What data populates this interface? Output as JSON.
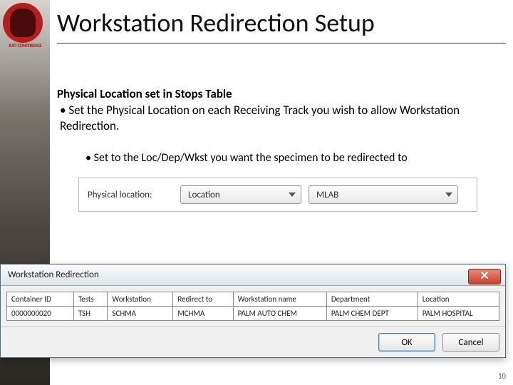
{
  "logo": {
    "caption": "JUST\nCONFERENCE"
  },
  "title": "Workstation Redirection Setup",
  "section_heading": "Physical Location set in Stops Table",
  "bullet_main": "Set the Physical Location on each Receiving Track you wish to allow Workstation Redirection.",
  "bullet_sub": "Set to the Loc/Dep/Wkst you want the specimen to be redirected to",
  "combo": {
    "label": "Physical location:",
    "type_value": "Location",
    "value": "MLAB"
  },
  "dialog": {
    "title": "Workstation Redirection",
    "columns": [
      "Container ID",
      "Tests",
      "Workstation",
      "Redirect to",
      "Workstation name",
      "Department",
      "Location"
    ],
    "rows": [
      {
        "container_id": "0000000020",
        "tests": "TSH",
        "workstation": "SCHMA",
        "redirect_to": "MCHMA",
        "workstation_name": "PALM AUTO CHEM",
        "department": "PALM CHEM DEPT",
        "location": "PALM HOSPITAL"
      }
    ],
    "ok_label": "OK",
    "cancel_label": "Cancel"
  },
  "page_number": "10"
}
